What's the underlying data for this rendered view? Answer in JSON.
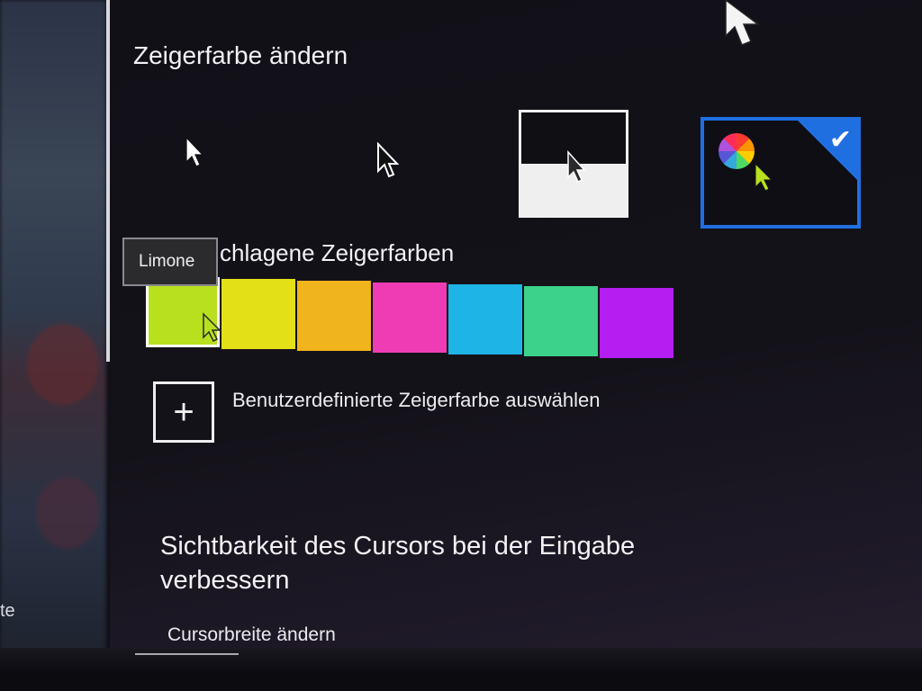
{
  "left_edge": {
    "partial_text": "te"
  },
  "pointer_color": {
    "heading": "Zeigerfarbe ändern",
    "schemes": [
      {
        "name": "white",
        "cursor_icon": "white-arrow-cursor"
      },
      {
        "name": "black",
        "cursor_icon": "black-arrow-cursor"
      },
      {
        "name": "inverted",
        "cursor_icon": "inverted-arrow-cursor"
      },
      {
        "name": "custom",
        "cursor_icon": "lime-arrow-cursor",
        "selected": true
      }
    ],
    "selected_check_icon": "checkmark-icon"
  },
  "suggested": {
    "heading": "chlagene Zeigerfarben",
    "tooltip": "Limone",
    "swatches": [
      {
        "name": "Limone",
        "color": "#b8e01e",
        "selected": true
      },
      {
        "name": "yellow",
        "color": "#e4e018"
      },
      {
        "name": "orange",
        "color": "#f0b41c"
      },
      {
        "name": "pink",
        "color": "#f03cb4"
      },
      {
        "name": "cyan",
        "color": "#1eb4e6"
      },
      {
        "name": "green",
        "color": "#3cd28c"
      },
      {
        "name": "purple",
        "color": "#b41ef0"
      }
    ]
  },
  "custom_color": {
    "plus": "+",
    "label": "Benutzerdefinierte Zeigerfarbe auswählen"
  },
  "visibility": {
    "heading": "Sichtbarkeit des Cursors bei der Eingabe verbessern",
    "cursor_width_label": "Cursorbreite ändern"
  },
  "colors": {
    "accent": "#1f6fe0",
    "selected_custom_cursor": "#b8e01e"
  }
}
